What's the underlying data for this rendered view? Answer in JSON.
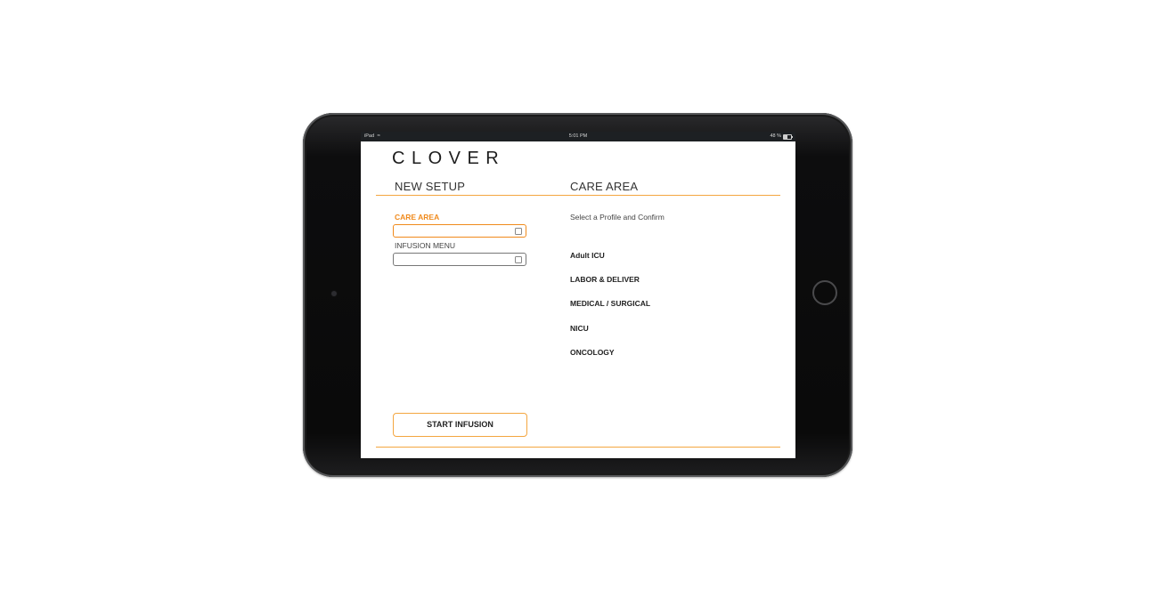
{
  "status_bar": {
    "device": "iPad",
    "wifi_icon": "wifi-icon",
    "time": "5:01 PM",
    "battery": "48 %",
    "battery_icon": "battery-icon"
  },
  "app": {
    "logo": "CLOVER",
    "accent_color": "#f08a1c"
  },
  "left_panel": {
    "title": "NEW SETUP",
    "care_area_label": "CARE AREA",
    "care_area_value": "",
    "infusion_menu_label": "INFUSION MENU",
    "infusion_menu_value": "",
    "start_button": "START INFUSION"
  },
  "right_panel": {
    "title": "CARE AREA",
    "instruction": "Select a Profile and Confirm",
    "profiles": [
      "Adult ICU",
      "LABOR & DELIVER",
      "MEDICAL / SURGICAL",
      "NICU",
      "ONCOLOGY"
    ]
  }
}
